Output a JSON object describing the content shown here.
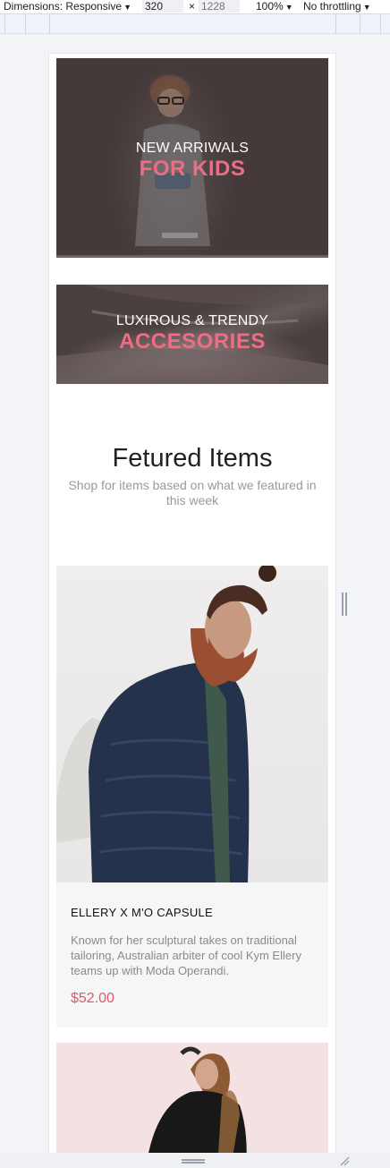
{
  "toolbar": {
    "dimensions_label": "Dimensions: Responsive",
    "width_value": "320",
    "times": "×",
    "height_placeholder": "1228",
    "zoom": "100%",
    "throttling": "No throttling"
  },
  "banners": [
    {
      "pre": "NEW ARRIWALS",
      "main": "FOR KIDS"
    },
    {
      "pre": "LUXIROUS & TRENDY",
      "main": "ACCESORIES"
    }
  ],
  "featured": {
    "title": "Fetured Items",
    "subtitle": "Shop for items based on what we featured in this week"
  },
  "products": [
    {
      "title": "ELLERY X M'O CAPSULE",
      "description": "Known for her sculptural takes on traditional tailoring, Australian arbiter of cool Kym Ellery teams up with Moda Operandi.",
      "price": "$52.00"
    }
  ],
  "colors": {
    "accent_pink": "#ee6d84",
    "price_pink": "#e0576e",
    "banner_overlay": "#453a3a"
  },
  "icons": {
    "dropdown": "caret-down-icon",
    "resize_side": "resize-handle-icon",
    "resize_bottom": "resize-handle-icon",
    "resize_corner": "resize-corner-icon"
  }
}
